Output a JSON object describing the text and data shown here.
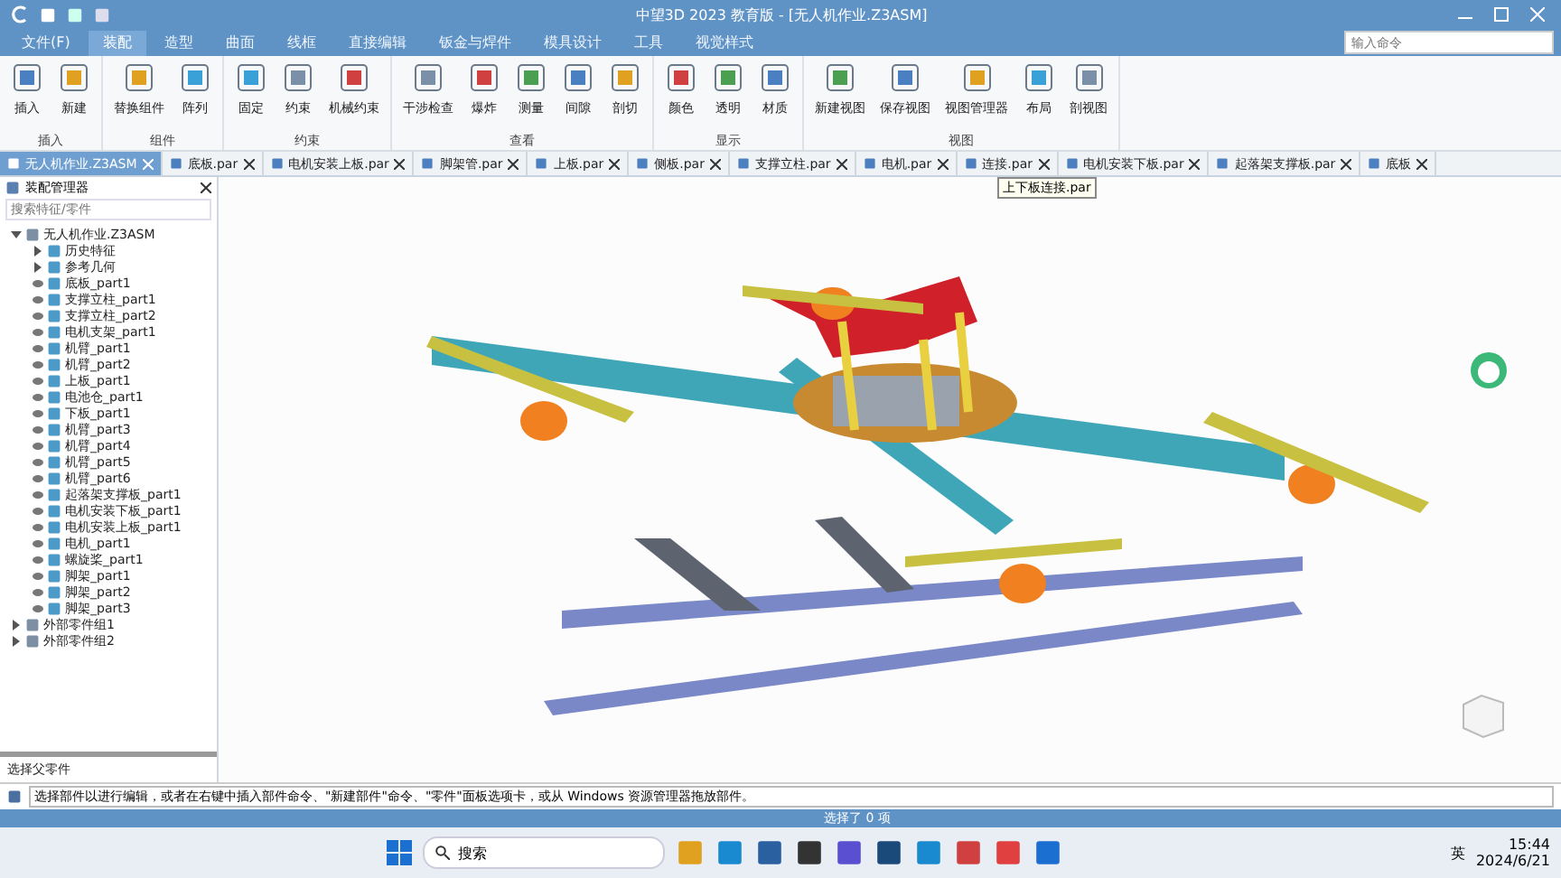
{
  "window": {
    "title": "中望3D 2023 教育版 - [无人机作业.Z3ASM]"
  },
  "menu": [
    {
      "label": "文件(F)",
      "selected": false
    },
    {
      "label": "装配",
      "selected": true
    },
    {
      "label": "造型",
      "selected": false
    },
    {
      "label": "曲面",
      "selected": false
    },
    {
      "label": "线框",
      "selected": false
    },
    {
      "label": "直接编辑",
      "selected": false
    },
    {
      "label": "钣金与焊件",
      "selected": false
    },
    {
      "label": "模具设计",
      "selected": false
    },
    {
      "label": "工具",
      "selected": false
    },
    {
      "label": "视觉样式",
      "selected": false
    }
  ],
  "search": {
    "placeholder": "输入命令"
  },
  "ribbon": [
    {
      "group": "插入",
      "buttons": [
        "插入",
        "新建"
      ]
    },
    {
      "group": "组件",
      "buttons": [
        "替换组件",
        "阵列"
      ]
    },
    {
      "group": "约束",
      "buttons": [
        "固定",
        "约束",
        "机械约束"
      ]
    },
    {
      "group": "查看",
      "buttons": [
        "干涉检查",
        "爆炸",
        "测量",
        "间隙",
        "剖切"
      ]
    },
    {
      "group": "显示",
      "buttons": [
        "颜色",
        "透明",
        "材质"
      ]
    },
    {
      "group": "视图",
      "buttons": [
        "新建视图",
        "保存视图",
        "视图管理器",
        "布局",
        "剖视图"
      ]
    }
  ],
  "doc_tabs": [
    {
      "label": "无人机作业.Z3ASM",
      "selected": true
    },
    {
      "label": "底板.par",
      "selected": false
    },
    {
      "label": "电机安装上板.par",
      "selected": false
    },
    {
      "label": "脚架管.par",
      "selected": false
    },
    {
      "label": "上板.par",
      "selected": false
    },
    {
      "label": "侧板.par",
      "selected": false
    },
    {
      "label": "支撑立柱.par",
      "selected": false
    },
    {
      "label": "电机.par",
      "selected": false
    },
    {
      "label": "连接.par",
      "selected": false
    },
    {
      "label": "电机安装下板.par",
      "selected": false
    },
    {
      "label": "起落架支撑板.par",
      "selected": false
    },
    {
      "label": "底板",
      "selected": false
    }
  ],
  "tooltip": "上下板连接.par",
  "assembly_manager": {
    "title": "装配管理器",
    "search_placeholder": "搜索特征/零件",
    "tree": [
      {
        "label": "无人机作业.Z3ASM",
        "expanded": true,
        "children": [
          {
            "label": "历史特征",
            "expanded": false
          },
          {
            "label": "参考几何",
            "expanded": false
          },
          {
            "label": "底板_part1"
          },
          {
            "label": "支撑立柱_part1"
          },
          {
            "label": "支撑立柱_part2"
          },
          {
            "label": "电机支架_part1"
          },
          {
            "label": "机臂_part1"
          },
          {
            "label": "机臂_part2"
          },
          {
            "label": "上板_part1"
          },
          {
            "label": "电池仓_part1"
          },
          {
            "label": "下板_part1"
          },
          {
            "label": "机臂_part3"
          },
          {
            "label": "机臂_part4"
          },
          {
            "label": "机臂_part5"
          },
          {
            "label": "机臂_part6"
          },
          {
            "label": "起落架支撑板_part1"
          },
          {
            "label": "电机安装下板_part1"
          },
          {
            "label": "电机安装上板_part1"
          },
          {
            "label": "电机_part1"
          },
          {
            "label": "螺旋桨_part1"
          },
          {
            "label": "脚架_part1"
          },
          {
            "label": "脚架_part2"
          },
          {
            "label": "脚架_part3"
          }
        ]
      },
      {
        "label": "外部零件组1",
        "expanded": false
      },
      {
        "label": "外部零件组2",
        "expanded": false
      }
    ],
    "footer": "选择父零件"
  },
  "command_line": "选择部件以进行编辑，或者在右键中插入部件命令、\"新建部件\"命令、\"零件\"面板选项卡，或从 Windows 资源管理器拖放部件。",
  "status_bar": {
    "text": "选择了 0 项"
  },
  "taskbar": {
    "search": "搜索",
    "ime": "英",
    "time": "15:44",
    "date": "2024/6/21"
  }
}
